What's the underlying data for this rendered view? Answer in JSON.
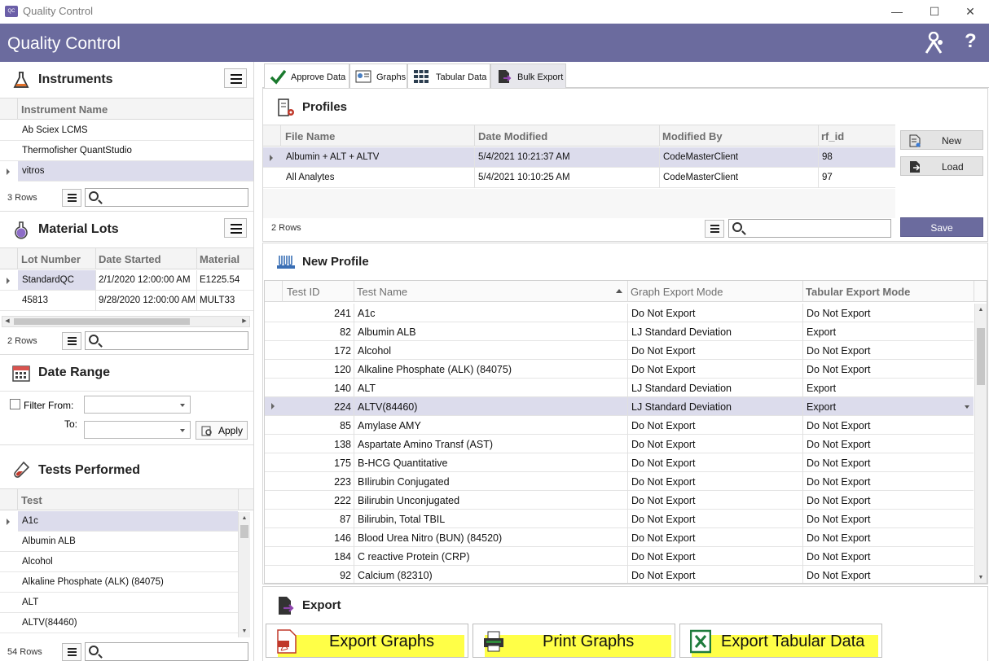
{
  "window": {
    "title": "Quality Control",
    "app_icon": "QC"
  },
  "header": {
    "title": "Quality Control",
    "icons": [
      "users-icon",
      "help-icon"
    ]
  },
  "instruments": {
    "title": "Instruments",
    "column": "Instrument Name",
    "rows": [
      "Ab Sciex LCMS",
      "Thermofisher QuantStudio",
      "vitros"
    ],
    "selected_index": 2,
    "row_count": "3 Rows"
  },
  "material_lots": {
    "title": "Material Lots",
    "columns": [
      "Lot Number",
      "Date Started",
      "Material"
    ],
    "rows": [
      [
        "StandardQC",
        "2/1/2020 12:00:00 AM",
        "E1225.54"
      ],
      [
        "45813",
        "9/28/2020 12:00:00 AM",
        "MULT33"
      ]
    ],
    "selected_index": 0,
    "row_count": "2 Rows"
  },
  "date_range": {
    "title": "Date Range",
    "filter_from_label": "Filter From:",
    "to_label": "To:",
    "apply_label": "Apply",
    "filter_from_checked": false
  },
  "tests_performed": {
    "title": "Tests Performed",
    "column": "Test",
    "rows": [
      "A1c",
      "Albumin ALB",
      "Alcohol",
      "Alkaline Phosphate (ALK) (84075)",
      "ALT",
      "ALTV(84460)"
    ],
    "selected_index": 0,
    "row_count": "54 Rows"
  },
  "tabs": [
    {
      "label": "Approve Data",
      "icon": "checkmark-icon"
    },
    {
      "label": "Graphs",
      "icon": "graph-icon"
    },
    {
      "label": "Tabular Data",
      "icon": "table-icon"
    },
    {
      "label": "Bulk Export",
      "icon": "export-icon",
      "active": true
    }
  ],
  "profiles": {
    "title": "Profiles",
    "columns": [
      "File Name",
      "Date Modified",
      "Modified By",
      "rf_id"
    ],
    "rows": [
      [
        "Albumin + ALT + ALTV",
        "5/4/2021 10:21:37 AM",
        "CodeMasterClient",
        "98"
      ],
      [
        "All Analytes",
        "5/4/2021 10:10:25 AM",
        "CodeMasterClient",
        "97"
      ]
    ],
    "selected_index": 0,
    "row_count": "2 Rows",
    "new_label": "New",
    "load_label": "Load",
    "save_label": "Save"
  },
  "new_profile": {
    "title": "New Profile",
    "columns": [
      "Test ID",
      "Test Name",
      "Graph Export Mode",
      "Tabular Export Mode"
    ],
    "rows": [
      [
        "241",
        "A1c",
        "Do Not Export",
        "Do Not Export"
      ],
      [
        "82",
        "Albumin ALB",
        "LJ Standard Deviation",
        "Export"
      ],
      [
        "172",
        "Alcohol",
        "Do Not Export",
        "Do Not Export"
      ],
      [
        "120",
        "Alkaline Phosphate (ALK) (84075)",
        "Do Not Export",
        "Do Not Export"
      ],
      [
        "140",
        "ALT",
        "LJ Standard Deviation",
        "Export"
      ],
      [
        "224",
        "ALTV(84460)",
        "LJ Standard Deviation",
        "Export"
      ],
      [
        "85",
        "Amylase AMY",
        "Do Not Export",
        "Do Not Export"
      ],
      [
        "138",
        "Aspartate Amino Transf (AST)",
        "Do Not Export",
        "Do Not Export"
      ],
      [
        "175",
        "B-HCG Quantitative",
        "Do Not Export",
        "Do Not Export"
      ],
      [
        "223",
        "BIlirubin Conjugated",
        "Do Not Export",
        "Do Not Export"
      ],
      [
        "222",
        "Bilirubin Unconjugated",
        "Do Not Export",
        "Do Not Export"
      ],
      [
        "87",
        "Bilirubin, Total TBIL",
        "Do Not Export",
        "Do Not Export"
      ],
      [
        "146",
        "Blood Urea Nitro (BUN) (84520)",
        "Do Not Export",
        "Do Not Export"
      ],
      [
        "184",
        "C reactive Protein (CRP)",
        "Do Not Export",
        "Do Not Export"
      ],
      [
        "92",
        "Calcium (82310)",
        "Do Not Export",
        "Do Not Export"
      ]
    ],
    "selected_index": 5
  },
  "export": {
    "title": "Export",
    "buttons": [
      {
        "label": "Export Graphs",
        "icon": "pdf-icon"
      },
      {
        "label": "Print Graphs",
        "icon": "printer-icon"
      },
      {
        "label": "Export Tabular Data",
        "icon": "excel-icon"
      }
    ]
  }
}
